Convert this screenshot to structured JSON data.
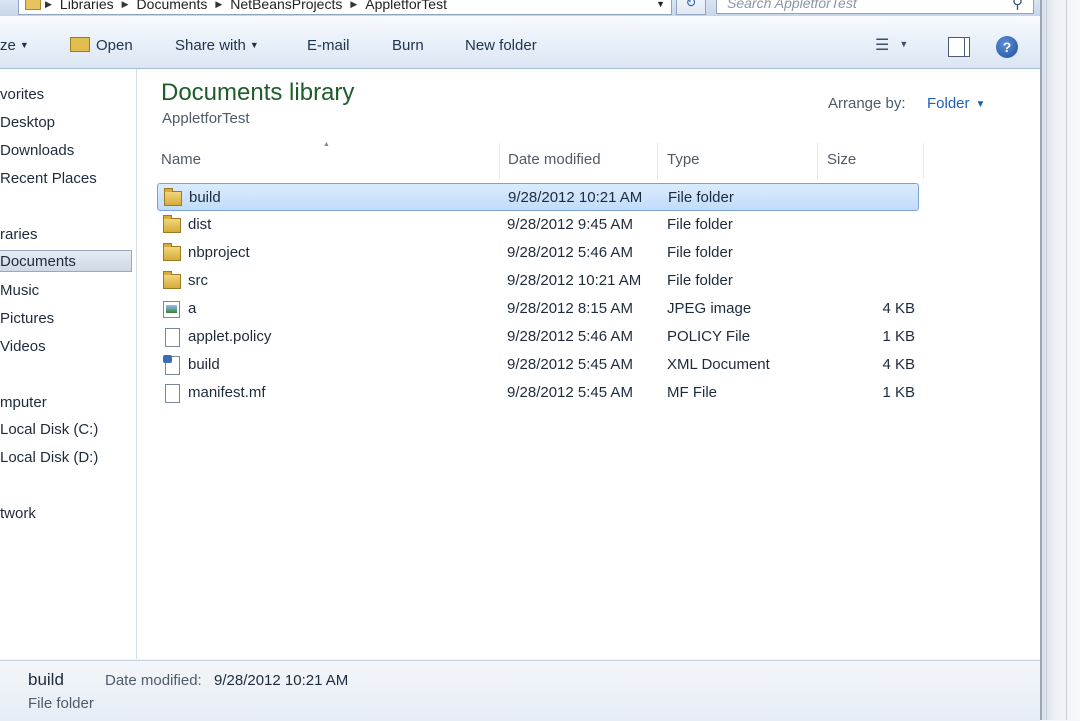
{
  "address": {
    "crumbs": [
      "Libraries",
      "Documents",
      "NetBeansProjects",
      "AppletforTest"
    ]
  },
  "search": {
    "placeholder": "Search AppletforTest"
  },
  "toolbar": {
    "organize": "ze",
    "open": "Open",
    "share_with": "Share with",
    "email": "E-mail",
    "burn": "Burn",
    "new_folder": "New folder"
  },
  "nav": {
    "items": [
      {
        "label": "vorites"
      },
      {
        "label": "Desktop"
      },
      {
        "label": "Downloads"
      },
      {
        "label": "Recent Places"
      },
      {
        "label": "raries"
      },
      {
        "label": "Documents"
      },
      {
        "label": "Music"
      },
      {
        "label": "Pictures"
      },
      {
        "label": "Videos"
      },
      {
        "label": "mputer"
      },
      {
        "label": "Local Disk (C:)"
      },
      {
        "label": "Local Disk (D:)"
      },
      {
        "label": "twork"
      }
    ]
  },
  "library": {
    "title": "Documents library",
    "subtitle": "AppletforTest",
    "arrange_label": "Arrange by:",
    "arrange_value": "Folder"
  },
  "columns": {
    "name": "Name",
    "date": "Date modified",
    "type": "Type",
    "size": "Size"
  },
  "files": [
    {
      "name": "build",
      "date": "9/28/2012 10:21 AM",
      "type": "File folder",
      "size": "",
      "icon": "folder-icon"
    },
    {
      "name": "dist",
      "date": "9/28/2012 9:45 AM",
      "type": "File folder",
      "size": "",
      "icon": "folder-icon"
    },
    {
      "name": "nbproject",
      "date": "9/28/2012 5:46 AM",
      "type": "File folder",
      "size": "",
      "icon": "folder-icon"
    },
    {
      "name": "src",
      "date": "9/28/2012 10:21 AM",
      "type": "File folder",
      "size": "",
      "icon": "folder-icon"
    },
    {
      "name": "a",
      "date": "9/28/2012 8:15 AM",
      "type": "JPEG image",
      "size": "4 KB",
      "icon": "image-file-icon"
    },
    {
      "name": "applet.policy",
      "date": "9/28/2012 5:46 AM",
      "type": "POLICY File",
      "size": "1 KB",
      "icon": "document-icon"
    },
    {
      "name": "build",
      "date": "9/28/2012 5:45 AM",
      "type": "XML Document",
      "size": "4 KB",
      "icon": "xml-file-icon"
    },
    {
      "name": "manifest.mf",
      "date": "9/28/2012 5:45 AM",
      "type": "MF File",
      "size": "1 KB",
      "icon": "document-icon"
    }
  ],
  "details": {
    "name": "build",
    "date_label": "Date modified:",
    "date_value": "9/28/2012 10:21 AM",
    "type": "File folder"
  }
}
